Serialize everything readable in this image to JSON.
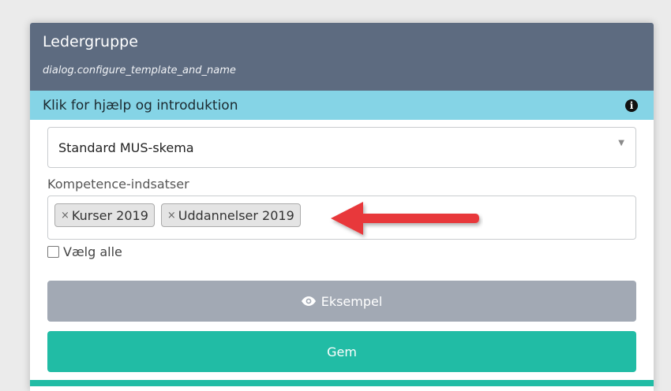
{
  "dialog": {
    "title": "Ledergruppe",
    "subtitle": "dialog.configure_template_and_name"
  },
  "help": {
    "label": "Klik for hjælp og introduktion",
    "icon": "info-icon"
  },
  "template_select": {
    "value": "Standard MUS-skema",
    "icon": "chevron-down-icon"
  },
  "competence": {
    "label": "Kompetence-indsatser",
    "tags": [
      {
        "remove": "×",
        "label": "Kurser 2019"
      },
      {
        "remove": "×",
        "label": "Uddannelser 2019"
      }
    ]
  },
  "select_all": {
    "label": "Vælg alle",
    "checked": false
  },
  "buttons": {
    "preview_label": "Eksempel",
    "preview_icon": "eye-icon",
    "save_label": "Gem"
  },
  "colors": {
    "header": "#5d6b80",
    "help_bar": "#85d4e6",
    "preview_button": "#a2a9b4",
    "save_button": "#21bca5",
    "annotation_arrow": "#e8393a"
  }
}
